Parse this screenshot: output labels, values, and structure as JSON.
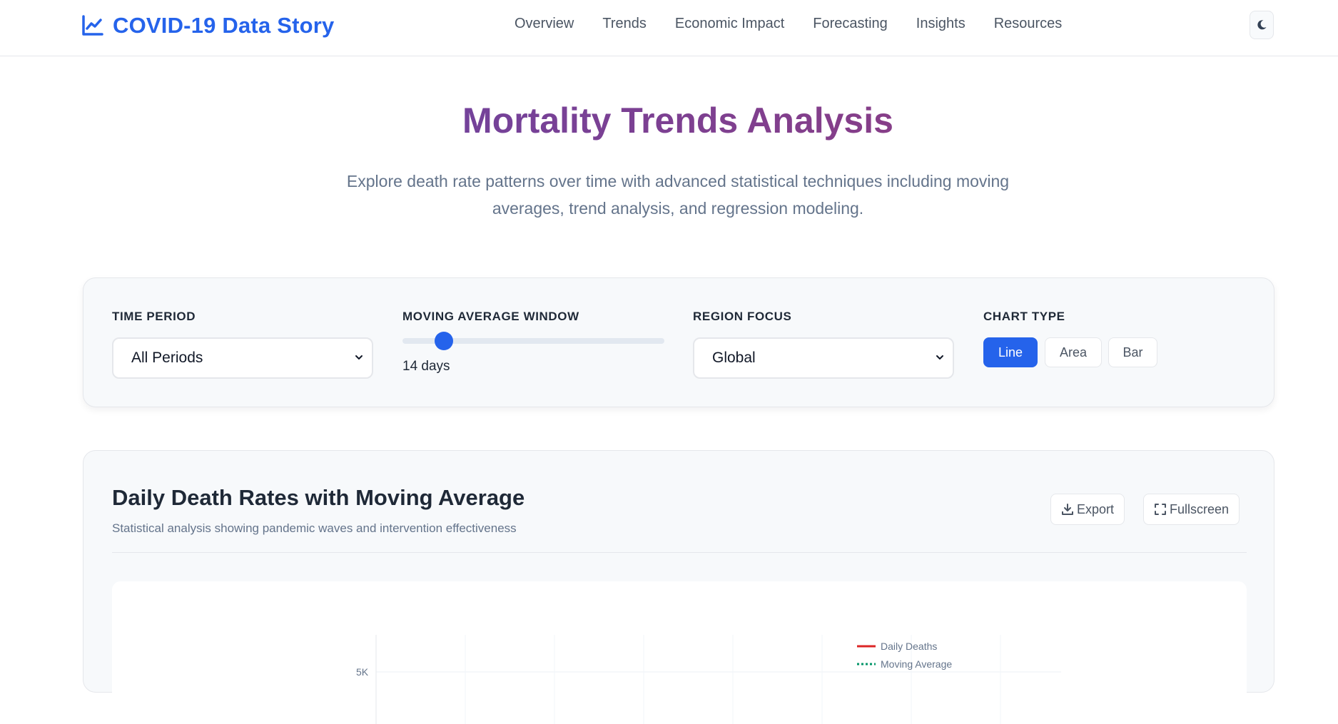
{
  "header": {
    "title": "COVID-19 Data Story",
    "nav": [
      "Overview",
      "Trends",
      "Economic Impact",
      "Forecasting",
      "Insights",
      "Resources"
    ],
    "theme_icon": "moon-icon"
  },
  "hero": {
    "title": "Mortality Trends Analysis",
    "subtitle_line1": "Explore death rate patterns over time with advanced statistical techniques including moving",
    "subtitle_line2": "averages, trend analysis, and regression modeling."
  },
  "controls": {
    "time_period": {
      "label": "Time Period",
      "value": "All Periods"
    },
    "moving_average": {
      "label": "Moving Average Window",
      "value_label": "14 days"
    },
    "region": {
      "label": "Region Focus",
      "value": "Global"
    },
    "chart_type": {
      "label": "Chart Type",
      "options": [
        "Line",
        "Area",
        "Bar"
      ],
      "selected": "Line"
    }
  },
  "chart_card": {
    "title": "Daily Death Rates with Moving Average",
    "subtitle": "Statistical analysis showing pandemic waves and intervention effectiveness",
    "export_label": "Export",
    "fullscreen_label": "Fullscreen"
  },
  "chart_data": {
    "type": "line",
    "title": "",
    "xlabel": "",
    "ylabel": "",
    "y_ticks": [
      "5K"
    ],
    "series": [
      {
        "name": "Daily Deaths",
        "values": []
      },
      {
        "name": "Moving Average",
        "values": []
      }
    ],
    "legend": "top-right",
    "grid": true
  },
  "colors": {
    "accent": "#2563eb",
    "title_gradient_start": "#6046ad",
    "title_gradient_end": "#9a3a75",
    "daily_deaths": "#dc2626",
    "moving_average": "#059669"
  }
}
